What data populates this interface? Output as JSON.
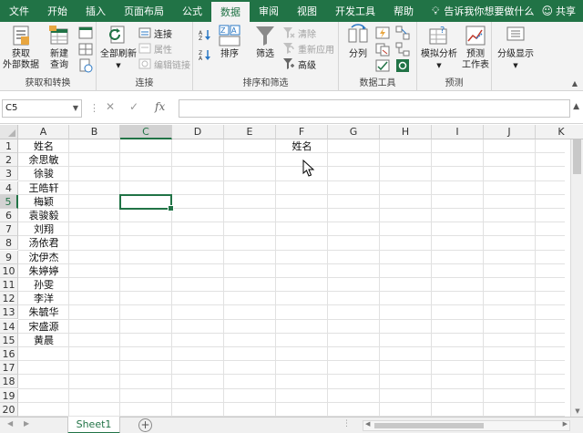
{
  "menu": {
    "tabs": [
      "文件",
      "开始",
      "插入",
      "页面布局",
      "公式",
      "数据",
      "审阅",
      "视图",
      "开发工具",
      "帮助"
    ],
    "active": "数据",
    "tell_me": "告诉我你想要做什么",
    "share": "共享"
  },
  "ribbon": {
    "get_external_line1": "获取",
    "get_external_line2": "外部数据",
    "new_query_line1": "新建",
    "new_query_line2": "查询",
    "group_get_transform": "获取和转换",
    "refresh_all": "全部刷新",
    "connections": "连接",
    "properties": "属性",
    "edit_links": "编辑链接",
    "group_connections": "连接",
    "sort": "排序",
    "filter": "筛选",
    "clear": "清除",
    "reapply": "重新应用",
    "advanced": "高级",
    "group_sort_filter": "排序和筛选",
    "text_to_columns": "分列",
    "group_data_tools": "数据工具",
    "what_if": "模拟分析",
    "forecast_line1": "预测",
    "forecast_line2": "工作表",
    "group_forecast": "预测",
    "outline": "分级显示"
  },
  "formula_bar": {
    "name_box": "C5",
    "formula": ""
  },
  "columns": [
    "A",
    "B",
    "C",
    "D",
    "E",
    "F",
    "G",
    "H",
    "I",
    "J",
    "K"
  ],
  "selected_column": "C",
  "rows": [
    "1",
    "2",
    "3",
    "4",
    "5",
    "6",
    "7",
    "8",
    "9",
    "10",
    "11",
    "12",
    "13",
    "14",
    "15",
    "16",
    "17",
    "18",
    "19",
    "20"
  ],
  "selected_row": "5",
  "column_a": [
    "姓名",
    "余思敏",
    "徐骏",
    "王皓轩",
    "梅颖",
    "袁骏毅",
    "刘翔",
    "汤依君",
    "沈伊杰",
    "朱婷婷",
    "孙雯",
    "李洋",
    "朱毓华",
    "宋盛源",
    "黄晨"
  ],
  "column_f": [
    "姓名"
  ],
  "sheet": {
    "tab_name": "Sheet1",
    "add_label": "+"
  },
  "colors": {
    "accent": "#217346",
    "ribbon_bg": "#f3f3f3"
  },
  "icons": [
    "lightbulb-icon",
    "person-icon",
    "cursor-icon"
  ]
}
